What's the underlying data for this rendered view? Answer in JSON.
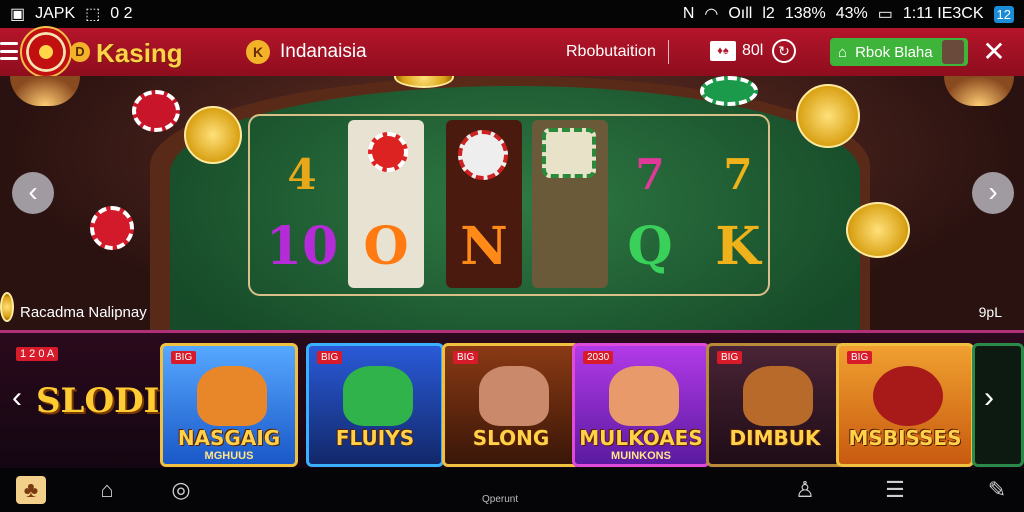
{
  "status_bar": {
    "left_icon": "image-icon",
    "left_text": "JAPK",
    "left_icon2": "square-icon",
    "left_text2": "0 2",
    "right_items": [
      "N",
      "WiFi",
      "Oıll",
      "l2",
      "138%",
      "43%",
      "1:11 IE3CK"
    ],
    "right_badge": "12"
  },
  "header": {
    "brand": "Kasing",
    "region": "Indanaisia",
    "nav_link": "Rbobutaition",
    "balance": "80l",
    "user_button": "Rbok Blaha",
    "colors": {
      "bar": "#a8121f",
      "brand": "#ffd24a",
      "user_button": "#3fb43a"
    }
  },
  "hero": {
    "reels": [
      {
        "top": "4",
        "bottom": "10",
        "top_color": "#e8a81a",
        "bottom_color": "#b62bd8"
      },
      {
        "top": "",
        "bottom": "O",
        "top_color": "#e3e3e3",
        "bottom_color": "#ff7a10"
      },
      {
        "top": "",
        "bottom": "N",
        "top_color": "#e3e3e3",
        "bottom_color": "#ff8a18"
      },
      {
        "top": "7",
        "bottom": "Q",
        "top_color": "#e0399a",
        "bottom_color": "#3ad15a"
      },
      {
        "top": "7",
        "bottom": "K",
        "top_color": "#f0b21a",
        "bottom_color": "#f0b21a"
      }
    ],
    "caption": "Racadma Nalipnay",
    "tag": "9pL"
  },
  "carousel": {
    "section_badge": "1 2 0 A",
    "section_title": "SLODIS",
    "cards": [
      {
        "tag": "BIG",
        "title": "NASGAIG",
        "subtitle": "MGHUUS",
        "bg": "#2a7ae0",
        "face": "#e8862a"
      },
      {
        "tag": "BIG",
        "title": "FLUIYS",
        "subtitle": "",
        "bg": "#1e3a8a",
        "face": "#2fb34a"
      },
      {
        "tag": "BIG",
        "title": "SLONG",
        "subtitle": "",
        "bg": "#6a2a10",
        "face": "#c9896a"
      },
      {
        "tag": "2030",
        "title": "MULKOAES",
        "subtitle": "MUINKONS",
        "bg": "#8a2ae0",
        "face": "#e89a6a"
      },
      {
        "tag": "BIG",
        "title": "DIMBUK",
        "subtitle": "",
        "bg": "#3a1a2a",
        "face": "#b86a2a"
      },
      {
        "tag": "BIG",
        "title": "MSBISSES",
        "subtitle": "",
        "bg": "#e0801a",
        "face": "#a81a1a"
      }
    ]
  },
  "bottom_nav": {
    "center_label": "Qperunt"
  }
}
